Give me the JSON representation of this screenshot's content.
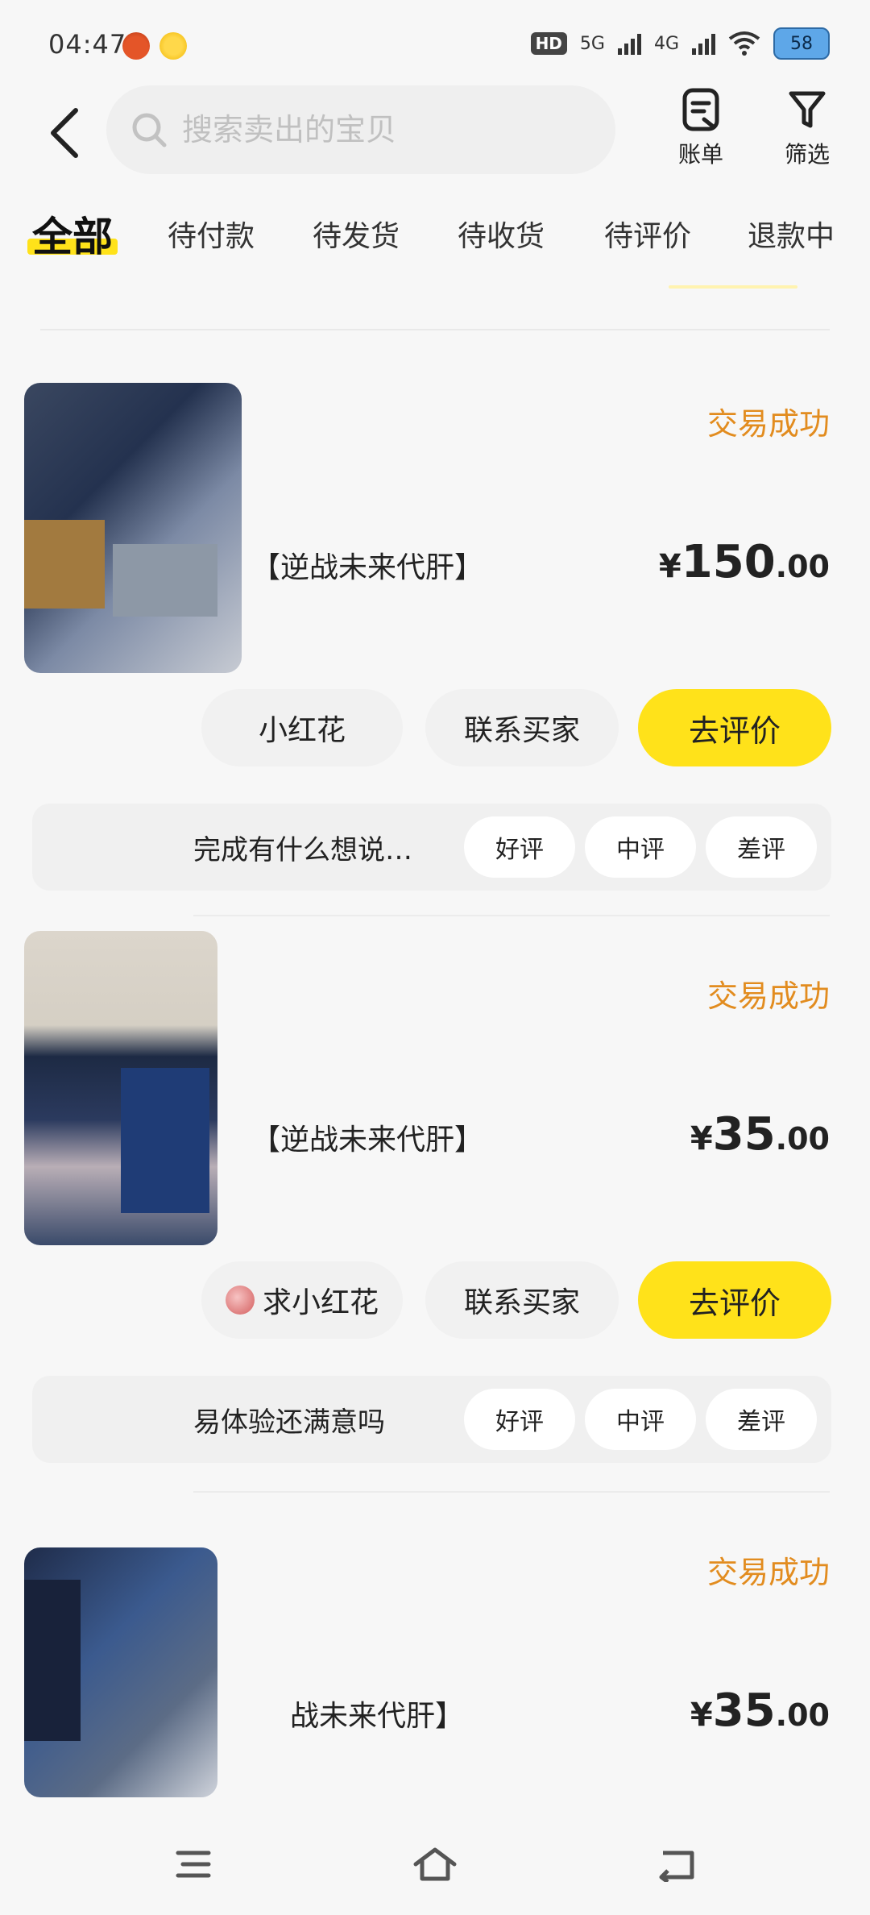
{
  "status_bar": {
    "time": "04:47",
    "network_1": "5G",
    "network_2": "4G",
    "hd_label": "HD",
    "battery": "58"
  },
  "header": {
    "search_placeholder": "搜索卖出的宝贝",
    "bill_label": "账单",
    "filter_label": "筛选"
  },
  "tabs": [
    {
      "label": "全部",
      "active": true
    },
    {
      "label": "待付款",
      "active": false
    },
    {
      "label": "待发货",
      "active": false
    },
    {
      "label": "待收货",
      "active": false
    },
    {
      "label": "待评价",
      "active": false
    },
    {
      "label": "退款中",
      "active": false
    }
  ],
  "orders": [
    {
      "status": "交易成功",
      "title": "【逆战未来代肝】",
      "price_currency": "¥",
      "price_int": "150",
      "price_dec": ".00",
      "buyer_pill": "小红花",
      "contact_label": "联系买家",
      "review_label": "去评价",
      "feedback_question": "完成有什么想说…",
      "ratings": [
        "好评",
        "中评",
        "差评"
      ]
    },
    {
      "status": "交易成功",
      "title": "【逆战未来代肝】",
      "price_currency": "¥",
      "price_int": "35",
      "price_dec": ".00",
      "buyer_pill": "求小红花",
      "contact_label": "联系买家",
      "review_label": "去评价",
      "feedback_question": "易体验还满意吗",
      "ratings": [
        "好评",
        "中评",
        "差评"
      ]
    },
    {
      "status": "交易成功",
      "title": "战未来代肝】",
      "price_currency": "¥",
      "price_int": "35",
      "price_dec": ".00"
    }
  ],
  "colors": {
    "accent_yellow": "#ffe21a",
    "status_orange": "#e28c1f",
    "background": "#f7f7f7"
  },
  "icons": {
    "back": "chevron-left-icon",
    "search": "search-icon",
    "bill": "bill-icon",
    "filter": "filter-icon",
    "nav_menu": "menu-icon",
    "nav_home": "home-icon",
    "nav_back": "back-icon"
  }
}
